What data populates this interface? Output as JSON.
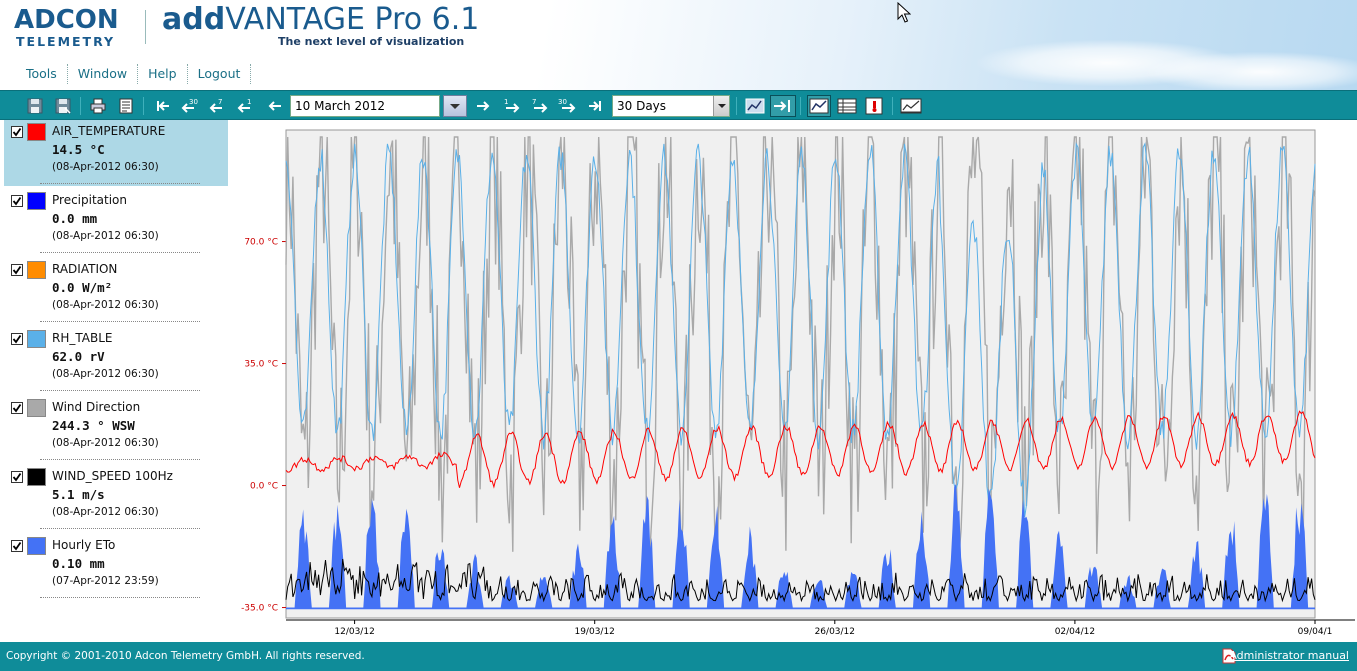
{
  "header": {
    "logo_main": "ADCON",
    "logo_sub": "TELEMETRY",
    "title_bold": "add",
    "title_rest": "VANTAGE Pro 6.1",
    "subtitle": "The next level of visualization"
  },
  "menu": [
    "Tools",
    "Window",
    "Help",
    "Logout"
  ],
  "toolbar": {
    "date_value": "10 March 2012",
    "period_value": "30 Days",
    "back_steps": [
      "30",
      "7",
      "1"
    ],
    "forward_steps": [
      "1",
      "7",
      "30"
    ]
  },
  "sensors": [
    {
      "name": "AIR_TEMPERATURE",
      "value": "14.5 °C",
      "timestamp": "(08-Apr-2012 06:30)",
      "color": "#ff0000",
      "checked": true,
      "selected": true
    },
    {
      "name": "Precipitation",
      "value": "0.0 mm",
      "timestamp": "(08-Apr-2012 06:30)",
      "color": "#0000ff",
      "checked": true,
      "selected": false
    },
    {
      "name": "RADIATION",
      "value": "0.0 W/m²",
      "timestamp": "(08-Apr-2012 06:30)",
      "color": "#ff8c00",
      "checked": true,
      "selected": false
    },
    {
      "name": "RH_TABLE",
      "value": "62.0 rV",
      "timestamp": "(08-Apr-2012 06:30)",
      "color": "#5ab0e8",
      "checked": true,
      "selected": false
    },
    {
      "name": "Wind Direction",
      "value": "244.3 ° WSW",
      "timestamp": "(08-Apr-2012 06:30)",
      "color": "#a9a9a9",
      "checked": true,
      "selected": false
    },
    {
      "name": "WIND_SPEED 100Hz",
      "value": "5.1 m/s",
      "timestamp": "(08-Apr-2012 06:30)",
      "color": "#000000",
      "checked": true,
      "selected": false
    },
    {
      "name": "Hourly ETo",
      "value": "0.10 mm",
      "timestamp": "(07-Apr-2012 23:59)",
      "color": "#4472f5",
      "checked": true,
      "selected": false
    }
  ],
  "chart_data": {
    "type": "line",
    "y_unit": "°C",
    "y_ticks": [
      -35,
      0,
      35,
      70
    ],
    "y_tick_labels": [
      "-35.0 °C",
      "0.0 °C",
      "35.0 °C",
      "70.0 °C"
    ],
    "ylim": [
      -38,
      102
    ],
    "x_ticks": [
      "12/03/12",
      "19/03/12",
      "26/03/12",
      "02/04/12",
      "09/04/1"
    ],
    "x_start": "2012-03-10",
    "x_end": "2012-04-09",
    "grid": false,
    "background": "#f0f0f0",
    "series": [
      {
        "name": "AIR_TEMPERATURE",
        "color": "#ff0000",
        "kind": "line"
      },
      {
        "name": "RH_TABLE",
        "color": "#5ab0e8",
        "kind": "line"
      },
      {
        "name": "Wind Direction",
        "color": "#a9a9a9",
        "kind": "line"
      },
      {
        "name": "WIND_SPEED 100Hz",
        "color": "#000000",
        "kind": "line"
      },
      {
        "name": "Hourly ETo",
        "color": "#4472f5",
        "kind": "area"
      }
    ]
  },
  "footer": {
    "copyright": "Copyright © 2001-2010 Adcon Telemetry GmbH. All rights reserved.",
    "admin_link": "Administrator manual"
  }
}
